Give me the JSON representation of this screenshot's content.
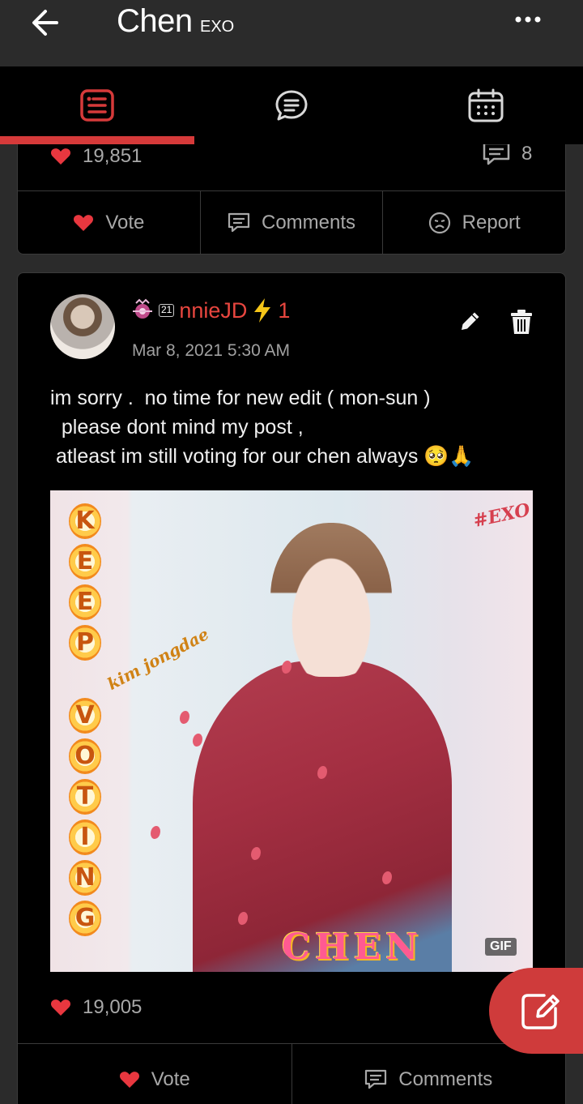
{
  "header": {
    "title": "Chen",
    "subtitle": "EXO"
  },
  "tabs": [
    {
      "name": "posts",
      "icon": "list-icon",
      "active": true
    },
    {
      "name": "chat",
      "icon": "chat-bubble-icon",
      "active": false
    },
    {
      "name": "calendar",
      "icon": "calendar-icon",
      "active": false
    }
  ],
  "colors": {
    "accent": "#d63a3a",
    "author": "#e8463f"
  },
  "card1": {
    "likes": "19,851",
    "comments": "8",
    "actions": {
      "vote": "Vote",
      "comments": "Comments",
      "report": "Report"
    }
  },
  "post": {
    "author_level": "21",
    "author_name": "nnieJD",
    "author_suffix": "1",
    "date": "Mar 8, 2021 5:30 AM",
    "text": "im sorry .  no time for new edit ( mon-sun )\n  please dont mind my post ,\n atleast im still voting for our chen always 🥺🙏",
    "image": {
      "keep_letters": [
        "K",
        "E",
        "E",
        "P"
      ],
      "voting_letters": [
        "V",
        "O",
        "T",
        "I",
        "N",
        "G"
      ],
      "script_text": "kim jongdae",
      "hashtag": "#EXO",
      "chen_text": "CHEN",
      "gif_label": "GIF"
    },
    "likes": "19,005",
    "actions": {
      "vote": "Vote",
      "comments": "Comments"
    }
  }
}
